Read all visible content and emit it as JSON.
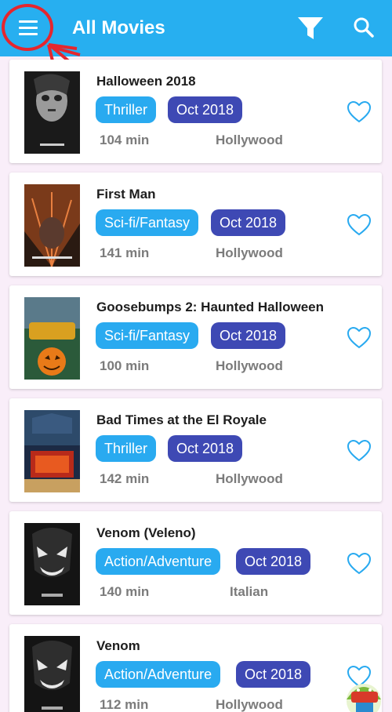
{
  "appbar": {
    "title": "All Movies"
  },
  "colors": {
    "appbar": "#27aff0",
    "genre_chip": "#29aaf0",
    "date_chip": "#3e49b4",
    "heart": "#29aaf0",
    "annotation": "#e5262e"
  },
  "icons": {
    "menu": "menu-icon",
    "filter": "filter-icon",
    "search": "search-icon",
    "favorite": "heart-icon"
  },
  "movies": [
    {
      "title": "Halloween 2018",
      "genre": "Thriller",
      "date": "Oct 2018",
      "duration": "104 min",
      "industry": "Hollywood"
    },
    {
      "title": "First Man",
      "genre": "Sci-fi/Fantasy",
      "date": "Oct 2018",
      "duration": "141 min",
      "industry": "Hollywood"
    },
    {
      "title": "Goosebumps 2: Haunted Halloween",
      "genre": "Sci-fi/Fantasy",
      "date": "Oct 2018",
      "duration": "100 min",
      "industry": "Hollywood"
    },
    {
      "title": "Bad Times at the El Royale",
      "genre": "Thriller",
      "date": "Oct 2018",
      "duration": "142 min",
      "industry": "Hollywood"
    },
    {
      "title": "Venom (Veleno)",
      "genre": "Action/Adventure",
      "date": "Oct 2018",
      "duration": "140 min",
      "industry": "Italian"
    },
    {
      "title": "Venom",
      "genre": "Action/Adventure",
      "date": "Oct 2018",
      "duration": "112 min",
      "industry": "Hollywood"
    }
  ]
}
